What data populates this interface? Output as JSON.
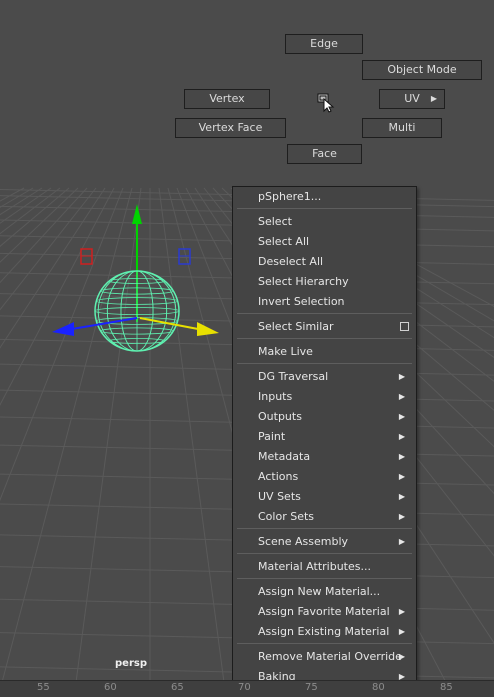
{
  "viewport": {
    "camera_label": "persp",
    "object_wire_color": "#5ff0b0",
    "axis_colors": {
      "x": "#e8e000",
      "y": "#00d400",
      "z": "#1a22ff",
      "handles_x": "#d02020",
      "handles_z": "#2b3bd0"
    }
  },
  "marking_menu": {
    "edge": "Edge",
    "object_mode": "Object Mode",
    "vertex": "Vertex",
    "uv": "UV",
    "vertex_face": "Vertex Face",
    "multi": "Multi",
    "face": "Face"
  },
  "context_menu": {
    "title": "pSphere1...",
    "items": [
      {
        "label": "Select"
      },
      {
        "label": "Select All"
      },
      {
        "label": "Deselect All"
      },
      {
        "label": "Select Hierarchy"
      },
      {
        "label": "Invert Selection"
      },
      {
        "label": "Select Similar"
      },
      {
        "label": "Make Live"
      },
      {
        "label": "DG Traversal"
      },
      {
        "label": "Inputs"
      },
      {
        "label": "Outputs"
      },
      {
        "label": "Paint"
      },
      {
        "label": "Metadata"
      },
      {
        "label": "Actions"
      },
      {
        "label": "UV Sets"
      },
      {
        "label": "Color Sets"
      },
      {
        "label": "Scene Assembly"
      },
      {
        "label": "Material Attributes..."
      },
      {
        "label": "Assign New Material..."
      },
      {
        "label": "Assign Favorite Material"
      },
      {
        "label": "Assign Existing Material"
      },
      {
        "label": "Remove Material Override"
      },
      {
        "label": "Baking"
      }
    ]
  },
  "timeline": {
    "ticks": [
      "55",
      "60",
      "65",
      "70",
      "75",
      "80",
      "85"
    ]
  }
}
